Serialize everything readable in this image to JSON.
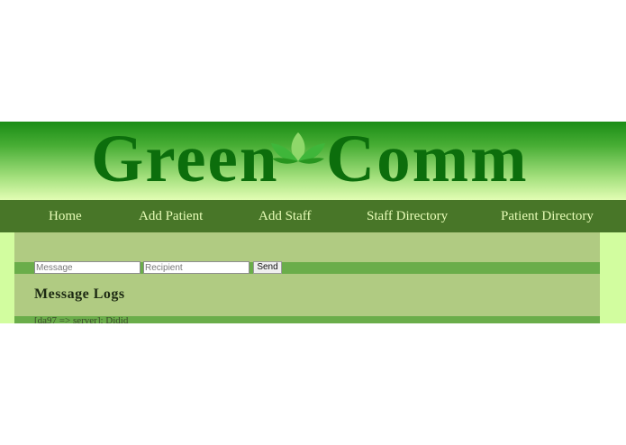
{
  "app": {
    "logo": {
      "word_left": "Green",
      "word_right": "Comm",
      "icon": "lotus-icon"
    }
  },
  "nav": {
    "items": [
      {
        "label": "Home"
      },
      {
        "label": "Add Patient"
      },
      {
        "label": "Add Staff"
      },
      {
        "label": "Staff Directory"
      },
      {
        "label": "Patient Directory"
      }
    ]
  },
  "composer": {
    "message_placeholder": "Message",
    "message_value": "",
    "recipient_placeholder": "Recipient",
    "recipient_value": "",
    "send_label": "Send"
  },
  "logs": {
    "title": "Message Logs",
    "entries": [
      "[da97 => server]: Didid"
    ]
  },
  "colors": {
    "nav_bg": "#487628",
    "nav_text": "#e7fcb7",
    "content_bg": "#b0cb82",
    "bar_bg": "#6aad4a",
    "logo_text": "#0c6e0c",
    "side_bg": "#d2fd9f"
  }
}
